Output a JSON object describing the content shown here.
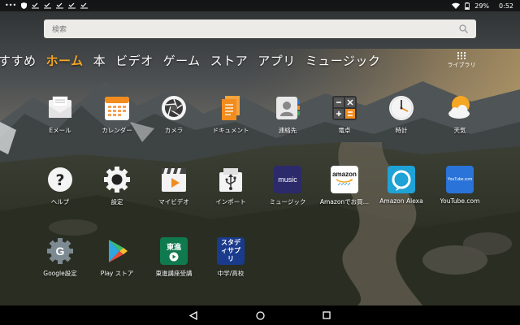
{
  "status_bar": {
    "battery": "29%",
    "time": "0:52"
  },
  "search": {
    "placeholder": "検索"
  },
  "tabs": [
    {
      "label": "すすめ",
      "active": false
    },
    {
      "label": "ホーム",
      "active": true
    },
    {
      "label": "本",
      "active": false
    },
    {
      "label": "ビデオ",
      "active": false
    },
    {
      "label": "ゲーム",
      "active": false
    },
    {
      "label": "ストア",
      "active": false
    },
    {
      "label": "アプリ",
      "active": false
    },
    {
      "label": "ミュージック",
      "active": false
    }
  ],
  "library_label": "ライブラリ",
  "apps": [
    {
      "label": "Eメール",
      "icon": "email-icon"
    },
    {
      "label": "カレンダー",
      "icon": "calendar-icon"
    },
    {
      "label": "カメラ",
      "icon": "camera-icon"
    },
    {
      "label": "ドキュメント",
      "icon": "documents-icon"
    },
    {
      "label": "連絡先",
      "icon": "contacts-icon"
    },
    {
      "label": "電卓",
      "icon": "calculator-icon"
    },
    {
      "label": "時計",
      "icon": "clock-icon"
    },
    {
      "label": "天気",
      "icon": "weather-icon"
    },
    {
      "label": "ヘルプ",
      "icon": "help-icon"
    },
    {
      "label": "設定",
      "icon": "settings-gear-icon"
    },
    {
      "label": "マイビデオ",
      "icon": "video-icon"
    },
    {
      "label": "インポート",
      "icon": "import-usb-icon"
    },
    {
      "label": "ミュージック",
      "icon": "music-icon",
      "icon_text": "music"
    },
    {
      "label": "Amazonでお買…",
      "icon": "amazon-shopping-icon",
      "icon_text": "amazon"
    },
    {
      "label": "Amazon Alexa",
      "icon": "alexa-icon"
    },
    {
      "label": "YouTube.com",
      "icon": "youtube-icon",
      "icon_text": "YouTube.com"
    },
    {
      "label": "Google設定",
      "icon": "google-settings-icon"
    },
    {
      "label": "Play ストア",
      "icon": "play-store-icon"
    },
    {
      "label": "東進講座受講",
      "icon": "toshin-icon",
      "icon_text": "東進"
    },
    {
      "label": "中学/高校",
      "icon": "study-sapuri-icon",
      "icon_text": "スタディサプリ"
    }
  ],
  "colors": {
    "active_tab": "#f5a623",
    "search_bg": "#ecebe8",
    "music_icon": "#2c2a6b",
    "alexa_icon": "#1fa2d6",
    "youtube_icon": "#2a73d8",
    "toshin_icon": "#0f7a4e",
    "sapuri_icon": "#1a3a8c"
  }
}
